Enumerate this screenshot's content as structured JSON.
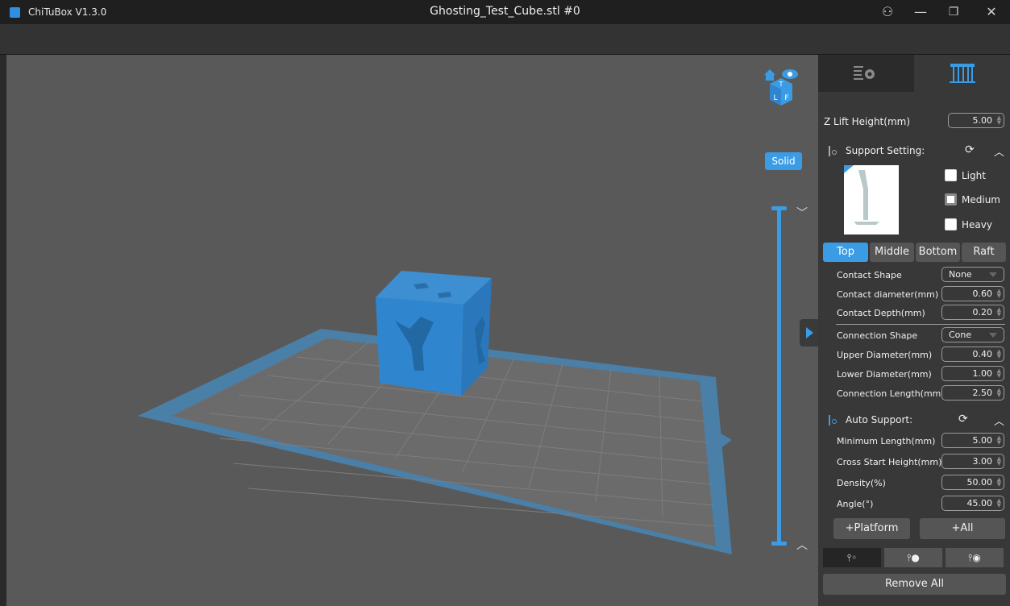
{
  "window": {
    "app_title": "ChiTuBox V1.3.0",
    "doc_title": "Ghosting_Test_Cube.stl #0",
    "controls": {
      "user": "⚇",
      "minimize": "—",
      "restore": "❐",
      "close": "✕"
    }
  },
  "viewport": {
    "solid_label": "Solid",
    "view_cube_letters": [
      "T",
      "L",
      "F"
    ],
    "cube_face_letters": [
      "Y",
      "X"
    ],
    "accent": "#3b9ce6",
    "background": "#595959"
  },
  "panel": {
    "tab_settings_icon": "settings-icon",
    "tab_support_icon": "support-icon",
    "z_lift": {
      "label": "Z Lift Height(mm)",
      "value": "5.00"
    },
    "support_setting": {
      "title": "Support Setting:",
      "presets": [
        "Light",
        "Medium",
        "Heavy"
      ],
      "selected_preset": "Medium",
      "tabs": [
        "Top",
        "Middle",
        "Bottom",
        "Raft"
      ],
      "active_tab": "Top",
      "rows": [
        {
          "label": "Contact Shape",
          "value": "None",
          "kind": "select"
        },
        {
          "label": "Contact diameter(mm)",
          "value": "0.60",
          "kind": "spin"
        },
        {
          "label": "Contact Depth(mm)",
          "value": "0.20",
          "kind": "spin"
        },
        {
          "label": "Connection Shape",
          "value": "Cone",
          "kind": "select"
        },
        {
          "label": "Upper Diameter(mm)",
          "value": "0.40",
          "kind": "spin"
        },
        {
          "label": "Lower Diameter(mm)",
          "value": "1.00",
          "kind": "spin"
        },
        {
          "label": "Connection Length(mm)",
          "value": "2.50",
          "kind": "spin"
        }
      ]
    },
    "auto_support": {
      "title": "Auto Support:",
      "rows": [
        {
          "label": "Minimum Length(mm)",
          "value": "5.00"
        },
        {
          "label": "Cross Start Height(mm)",
          "value": "3.00"
        },
        {
          "label": "Density(%)",
          "value": "50.00"
        },
        {
          "label": "Angle(°)",
          "value": "45.00"
        }
      ],
      "platform_label": "+Platform",
      "all_label": "+All"
    },
    "tools": [
      "support-add-icon",
      "support-remove-icon",
      "support-edit-icon"
    ],
    "remove_all_label": "Remove All"
  }
}
